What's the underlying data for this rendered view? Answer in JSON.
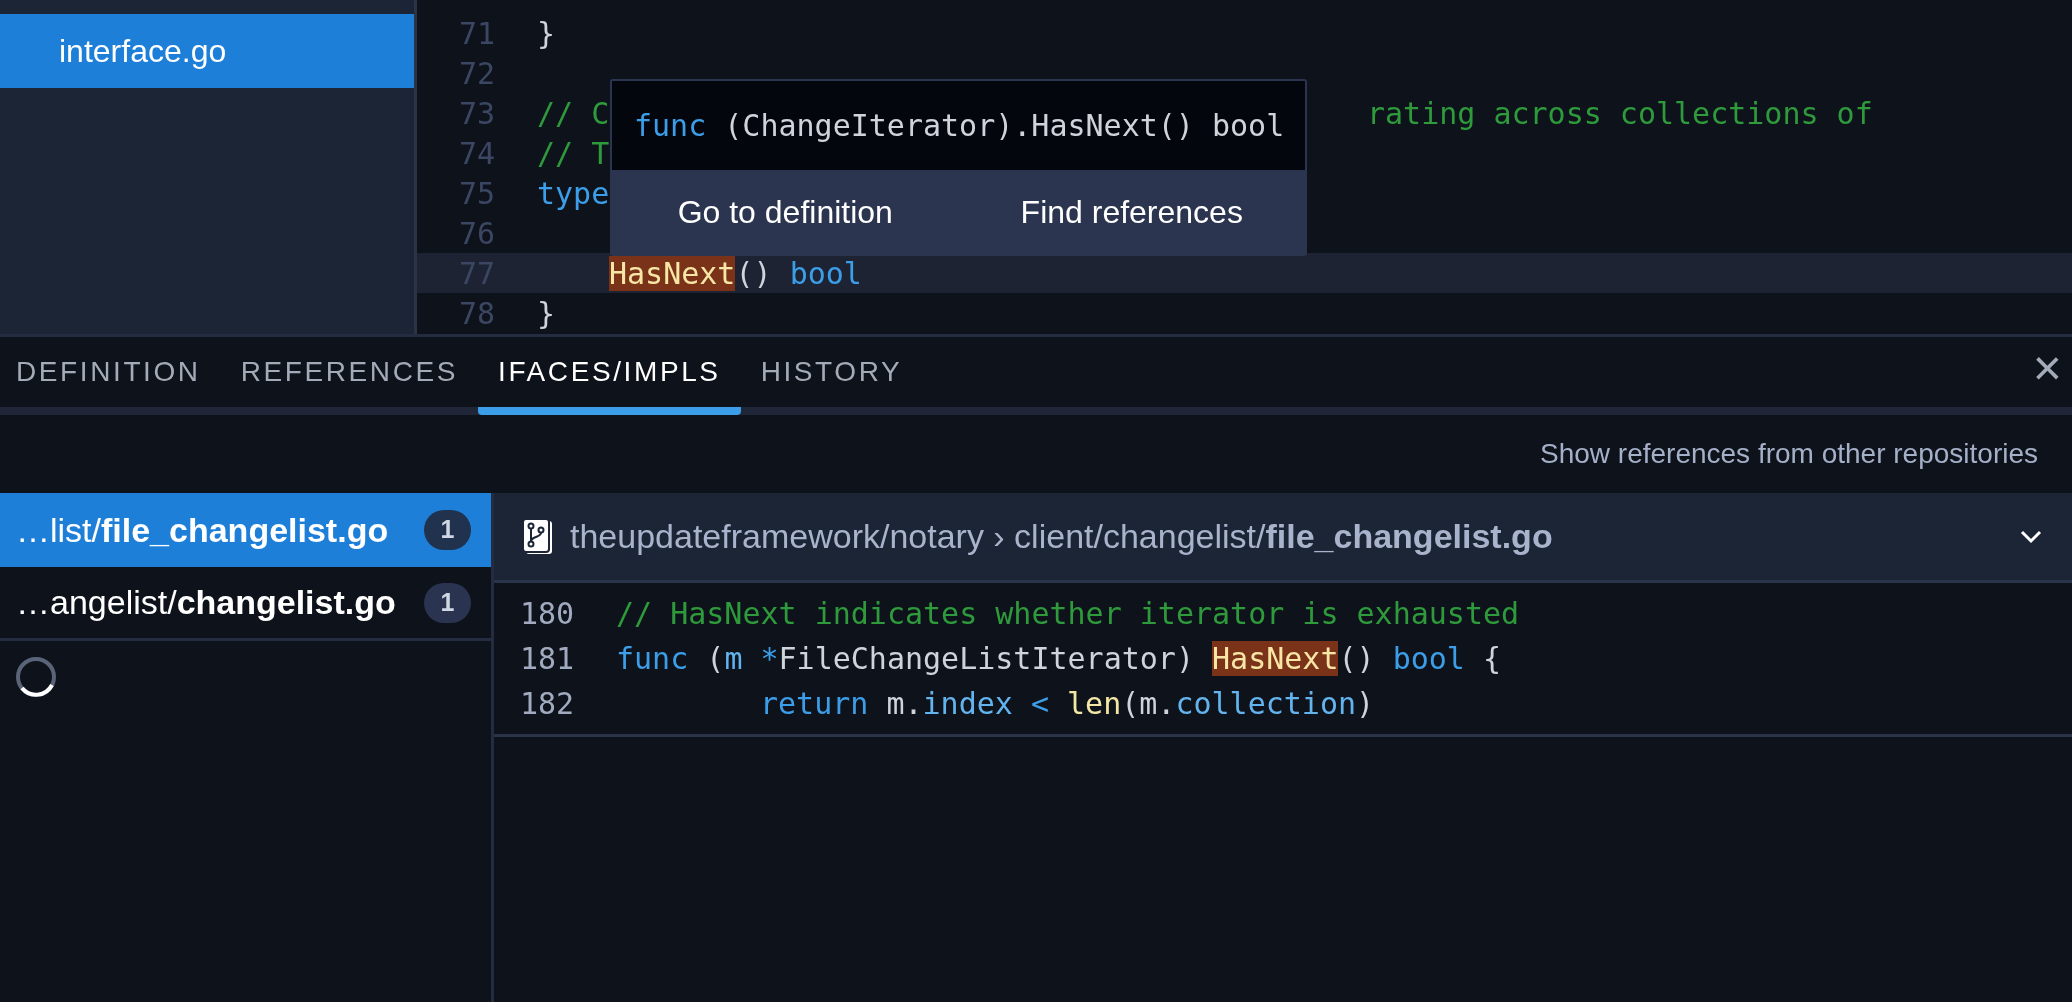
{
  "sidebar": {
    "items": [
      {
        "label": "interface.go",
        "selected": true
      }
    ]
  },
  "editor": {
    "lines": [
      {
        "number": "71",
        "highlighted": false,
        "tokens": [
          {
            "kind": "text",
            "t": "}"
          }
        ]
      },
      {
        "number": "72",
        "highlighted": false
      },
      {
        "number": "73",
        "highlighted": false,
        "tokens": [
          {
            "kind": "comment",
            "t": "// C"
          }
        ],
        "tokens_after_popup": [
          {
            "kind": "comment",
            "t": "rating across collections of"
          }
        ]
      },
      {
        "number": "74",
        "highlighted": false,
        "tokens": [
          {
            "kind": "comment",
            "t": "// T"
          }
        ]
      },
      {
        "number": "75",
        "highlighted": false,
        "tokens": [
          {
            "kind": "keyword",
            "t": "type"
          }
        ]
      },
      {
        "number": "76",
        "highlighted": false
      },
      {
        "number": "77",
        "highlighted": true,
        "indented": true,
        "tokens": [
          {
            "kind": "match",
            "t": "HasNext"
          },
          {
            "kind": "text",
            "t": "() "
          },
          {
            "kind": "keyword",
            "t": "bool"
          }
        ]
      },
      {
        "number": "78",
        "highlighted": false,
        "tokens": [
          {
            "kind": "text",
            "t": "}"
          }
        ]
      }
    ],
    "popup": {
      "signature": [
        {
          "kind": "keyword",
          "t": "func"
        },
        {
          "kind": "text",
          "t": " (ChangeIterator).HasNext() bool"
        }
      ],
      "actions": [
        "Go to definition",
        "Find references"
      ]
    }
  },
  "panel": {
    "tabs": [
      {
        "label": "DEFINITION",
        "selected": false
      },
      {
        "label": "REFERENCES",
        "selected": false
      },
      {
        "label": "IFACES/IMPLS",
        "selected": true
      },
      {
        "label": "HISTORY",
        "selected": false
      }
    ],
    "close": "×",
    "toggle": "Show references from other repositories",
    "files": [
      {
        "path": "…list/**file_changelist.go**",
        "count": "1",
        "selected": true
      },
      {
        "path": "…angelist/**changelist.go**",
        "count": "1",
        "selected": false
      }
    ],
    "loading": true,
    "file_header": {
      "path": "theupdateframework/notary › client/changelist/**file_changelist.go**"
    },
    "lines": [
      {
        "number": "180",
        "tokens": [
          {
            "kind": "comment",
            "t": "// HasNext indicates whether iterator is exhausted"
          }
        ]
      },
      {
        "number": "181",
        "tokens": [
          {
            "kind": "keyword",
            "t": "func"
          },
          {
            "kind": "text",
            "t": " ("
          },
          {
            "kind": "field",
            "t": "m"
          },
          {
            "kind": "keyword",
            "t": " *"
          },
          {
            "kind": "text",
            "t": "FileChangeListIterator) "
          },
          {
            "kind": "match",
            "t": "HasNext"
          },
          {
            "kind": "text",
            "t": "() "
          },
          {
            "kind": "keyword",
            "t": "bool"
          },
          {
            "kind": "text",
            "t": " {"
          }
        ]
      },
      {
        "number": "182",
        "indented": true,
        "tokens": [
          {
            "kind": "keyword",
            "t": "return"
          },
          {
            "kind": "text",
            "t": " m."
          },
          {
            "kind": "field",
            "t": "index"
          },
          {
            "kind": "keyword",
            "t": " < "
          },
          {
            "kind": "builtin",
            "t": "len"
          },
          {
            "kind": "text",
            "t": "(m."
          },
          {
            "kind": "field",
            "t": "collection"
          },
          {
            "kind": "text",
            "t": ")"
          }
        ]
      }
    ]
  }
}
